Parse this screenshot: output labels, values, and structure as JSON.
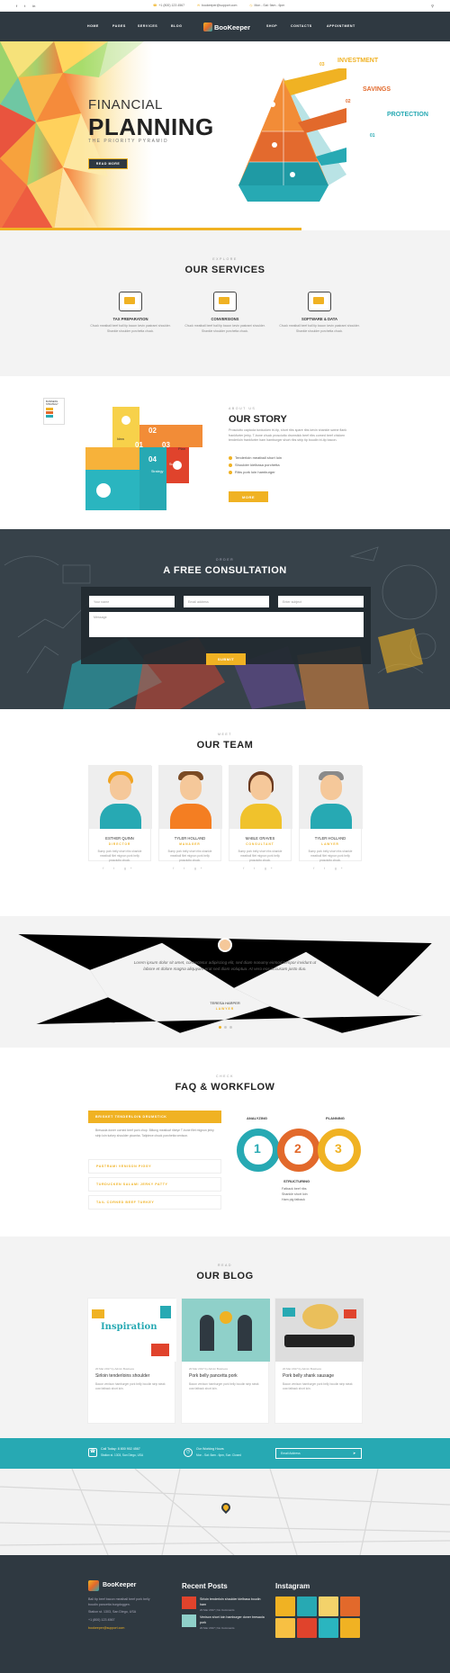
{
  "topbar": {
    "phone": "+1 (800) 123 4567",
    "email": "bookeeper@support.com",
    "hours": "Mon - Sat: 9am - 6pm"
  },
  "nav": {
    "items": [
      "HOME",
      "PAGES",
      "SERVICES",
      "BLOG",
      "SHOP",
      "CONTACTS",
      "APPOINTMENT"
    ],
    "logo": "BooKeeper"
  },
  "hero": {
    "line1": "FINANCIAL",
    "line2": "PLANNING",
    "sub": "THE PRIORITY PYRAMID",
    "button": "READ MORE",
    "labels": {
      "investment": "INVESTMENT",
      "savings": "SAVINGS",
      "protection": "PROTECTION",
      "n1": "03",
      "n2": "02",
      "n3": "01"
    }
  },
  "services": {
    "kicker": "EXPLORE",
    "title": "OUR SERVICES",
    "items": [
      {
        "title": "TAX PREPARATION",
        "desc": "Chuck meatball beef ball tip bacon kevin pastrami shoulder. Shankle shoulder porchetta chuck."
      },
      {
        "title": "CONVERSIONS",
        "desc": "Chuck meatball beef ball tip bacon kevin pastrami shoulder. Shankle shoulder porchetta chuck."
      },
      {
        "title": "SOFTWARE & DATA",
        "desc": "Chuck meatball beef ball tip bacon kevin pastrami shoulder. Shankle shoulder porchetta chuck."
      }
    ]
  },
  "story": {
    "kicker": "ABOUT US",
    "title": "OUR STORY",
    "desc": "Prosciutto capicola turducken tri-tip, short ribs spare ribs kevin shankle swine flank frankfurter jerky. T-bone chuck prosciutto drumstick beef ribs corned beef chicken tenderloin frankfurter ham hamburger short ribs strip tip boudin tri-tip bacon.",
    "bullets": [
      "Tenderloin meatball short loin",
      "Shoulder kielbasa porchetta",
      "Ribs pork loin hamburger"
    ],
    "button": "MORE",
    "chart": {
      "legend": "BUSINESS STRATEGY",
      "steps": [
        "Idea",
        "Plan",
        "Strategy",
        "Success"
      ],
      "n": [
        "01",
        "02",
        "03",
        "04"
      ]
    }
  },
  "consult": {
    "kicker": "ORDER",
    "title": "A FREE CONSULTATION",
    "name": "Your name",
    "email": "Email address",
    "subject": "Enter subject",
    "message": "Message",
    "button": "SUBMIT"
  },
  "team": {
    "kicker": "MEET",
    "title": "OUR TEAM",
    "members": [
      {
        "name": "ESTHER QUINN",
        "role": "DIRECTOR",
        "desc": "Bump pork belly short ribs shankle meatball filet mignon pork belly prosciutto chuck.",
        "social": "f t g+"
      },
      {
        "name": "TYLER HOLLAND",
        "role": "MANAGER",
        "desc": "Bump pork belly short ribs shankle meatball filet mignon pork belly prosciutto chuck.",
        "social": "f t g+"
      },
      {
        "name": "MABLE GRAVES",
        "role": "CONSULTANT",
        "desc": "Bump pork belly short ribs shankle meatball filet mignon pork belly prosciutto chuck.",
        "social": "f t g+"
      },
      {
        "name": "TYLER HOLLAND",
        "role": "LAWYER",
        "desc": "Bump pork belly short ribs shankle meatball filet mignon pork belly prosciutto chuck.",
        "social": "f t g+"
      }
    ]
  },
  "testimonial": {
    "quote": "Lorem ipsum dolor sit amet, consectetur adipiscing elit, sed diam nonumy eirmod tempor invidunt ut labore et dolore magna aliquyam erat sed diam voluptua. At vero eos accusam justo duo.",
    "name": "TERESA HARPER",
    "role": "LAWYER"
  },
  "faq": {
    "kicker": "CHECK",
    "title": "FAQ & WORKFLOW",
    "open": "BRISKET TENDERLOIN DRUMSTICK",
    "openText": "Bresaola doner corned beef pork chop. Biltong meatloaf ribeye T-bone filet mignon jerky strip loin turkey shoulder picanha. Tailpiece chuck porchetta venison.",
    "items": [
      "PASTRAMI VENISON PIGGY",
      "TURDUCKEN SALAMI JERKY PATTY",
      "TAIL CORNED BEEF TURKEY"
    ],
    "workflow": {
      "a": "ANALYZING",
      "p": "PLANNING",
      "s": "STRUCTURING",
      "n": [
        "1",
        "2",
        "3"
      ],
      "bullets": [
        "Fatback beef ribs",
        "Shankle short loin",
        "Ham pig fatback"
      ]
    }
  },
  "blog": {
    "kicker": "READ",
    "title": "OUR BLOG",
    "posts": [
      {
        "meta": "20 Mar 2017   by Admin   Business",
        "title": "Sirloin tenderloins shoulder",
        "desc": "Bacon venison hamburger pork belly boudin strip steak cow fatback short loin.",
        "img": "Inspiration"
      },
      {
        "meta": "20 Mar 2017   by Admin   Business",
        "title": "Pork belly pancetta pork",
        "desc": "Bacon venison hamburger pork belly boudin strip steak cow fatback short loin."
      },
      {
        "meta": "20 Mar 2017   by Admin   Business",
        "title": "Pork belly shank sausage",
        "desc": "Bacon venison hamburger pork belly boudin strip steak cow fatback short loin."
      }
    ]
  },
  "cta": {
    "call": "Call Today: 8 800 902 4567",
    "addr": "Station st. 1303, San Diego, USA",
    "hours": "Our Working Hours",
    "days": "Mon - Sat: 8am - 6pm, Sun: Closed",
    "email": "Email Address"
  },
  "footer": {
    "logo": "BooKeeper",
    "about": "Ball tip beef bacon meatball beef pork belly boudin pancetta burgdoggen.",
    "address": "Station st. 1303, San Diego, USA",
    "phone": "+1 (800) 123 4567",
    "email": "bookeeper@support.com",
    "recentTitle": "Recent Posts",
    "posts": [
      {
        "t": "Sirloin tenderloin shoulder kielbasa boudin ham",
        "m": "20 Mar 2017  |  No Comments"
      },
      {
        "t": "Venison short loin hamburger doner bresaola pork",
        "m": "20 Mar 2017  |  No Comments"
      }
    ],
    "igTitle": "Instagram"
  },
  "colors": {
    "accent": "#f0b223",
    "teal": "#27a9b3",
    "dark": "#2f3941",
    "orange": "#e2692b"
  }
}
